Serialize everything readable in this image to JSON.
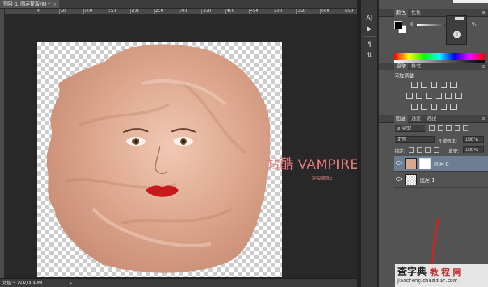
{
  "document": {
    "tab_label": "图层 0, 图层蒙版/8) *",
    "close_glyph": "×",
    "ruler_numbers": [
      "0",
      "50",
      "100",
      "150",
      "200",
      "250",
      "300",
      "350",
      "400",
      "450",
      "500",
      "550",
      "600",
      "650",
      "700"
    ]
  },
  "canvas": {
    "watermark": "站酷 VAMPIREE",
    "author": "@周鹏Rc"
  },
  "statusbar": {
    "doc_info": "文档:3.74M/4.47M",
    "arrow": "▸"
  },
  "site_mark": {
    "big_1": "查字典",
    "big_2": "教 程 网",
    "small": "jiaocheng.chazidian.com"
  },
  "color_panel": {
    "tabs": [
      "颜色",
      "色板"
    ],
    "channel_label": "K",
    "percent_sign": "%"
  },
  "adjust_panel": {
    "tabs": [
      "调整",
      "样式"
    ],
    "title": "添加调整"
  },
  "layers_panel": {
    "tabs": [
      "图层",
      "通道",
      "路径"
    ],
    "filter_kind": "ρ 类型",
    "blend_mode": "正常",
    "opacity_label": "不透明度:",
    "opacity_value": "100%",
    "lock_label": "锁定:",
    "fill_label": "填充:",
    "fill_value": "100%",
    "layers": [
      {
        "name": "图层 0",
        "selected": true
      },
      {
        "name": "图层 1",
        "selected": false
      }
    ]
  },
  "colors": {
    "accent_selected": "#6d7d93",
    "watermark": "#e27a7a",
    "lips": "#c81a1a"
  },
  "icons": {
    "info": "i",
    "panel_menu": "≡"
  }
}
